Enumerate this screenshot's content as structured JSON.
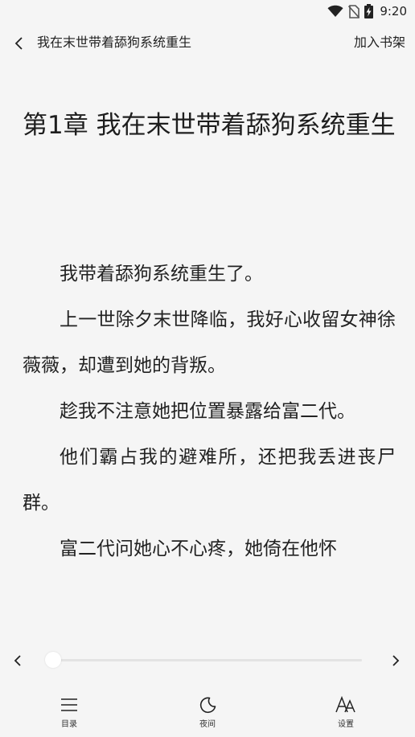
{
  "status_bar": {
    "time": "9:20",
    "icons": [
      "wifi-icon",
      "no-sim-icon",
      "battery-charging-icon"
    ]
  },
  "header": {
    "back_icon": "chevron-left-icon",
    "title": "我在末世带着舔狗系统重生",
    "add_to_shelf": "加入书架"
  },
  "chapter": {
    "title": "第1章 我在末世带着舔狗系统重生",
    "paragraphs": [
      "我带着舔狗系统重生了。",
      "上一世除夕末世降临，我好心收留女神徐薇薇，却遭到她的背叛。",
      "趁我不注意她把位置暴露给富二代。",
      "他们霸占我的避难所，还把我丢进丧尸群。",
      "富二代问她心不心疼，她倚在他怀"
    ]
  },
  "progress": {
    "prev_icon": "chevron-left-icon",
    "next_icon": "chevron-right-icon",
    "value": 0.0
  },
  "bottom_nav": {
    "toc_label": "目录",
    "night_label": "夜间",
    "settings_label": "设置"
  }
}
